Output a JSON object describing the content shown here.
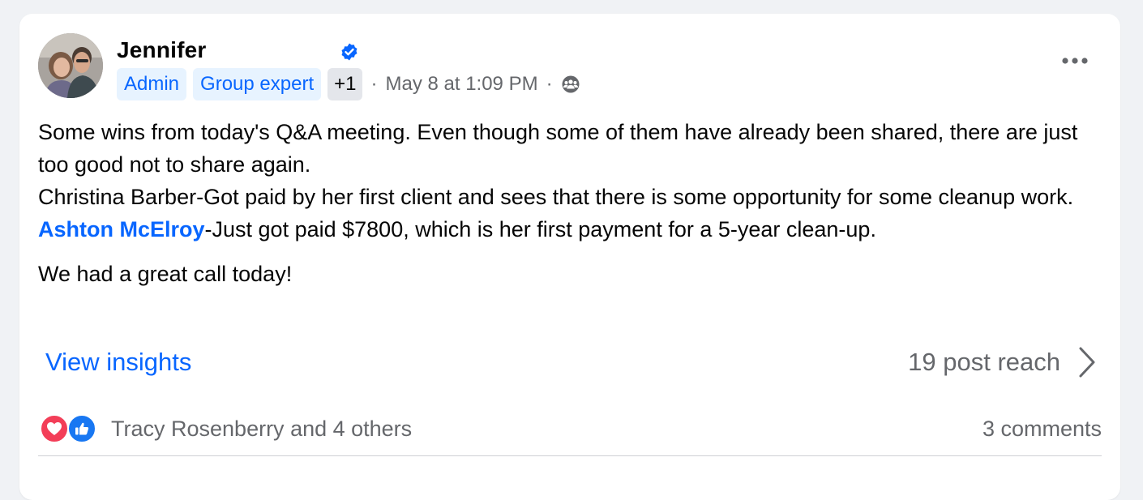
{
  "post": {
    "author_name": "Jennifer",
    "badges": [
      "Admin",
      "Group expert"
    ],
    "extra_badges": "+1",
    "separator": "·",
    "timestamp": "May 8 at 1:09 PM",
    "audience_icon": "group-audience-icon",
    "more_icon": "more-options-icon",
    "body": {
      "para1": "Some wins from today's Q&A meeting. Even though some of them have already been shared, there are just too good not to share again.",
      "para2": "Christina Barber-Got paid by her first client and sees that there is some opportunity for some cleanup work.",
      "mention": "Ashton McElroy",
      "para3_rest": "-Just got paid $7800, which is her first payment for a 5-year clean-up.",
      "para4": "We had a great call today!"
    },
    "insights": {
      "link_label": "View insights",
      "reach_label": "19 post reach"
    },
    "reactions": {
      "icons": [
        "love-reaction-icon",
        "like-reaction-icon"
      ],
      "summary": "Tracy Rosenberry and 4 others",
      "comments": "3 comments"
    }
  },
  "colors": {
    "accent": "#0866ff",
    "secondary_text": "#65676b",
    "badge_bg": "#e7f3ff",
    "love": "#f33e58",
    "like": "#1877f2"
  }
}
